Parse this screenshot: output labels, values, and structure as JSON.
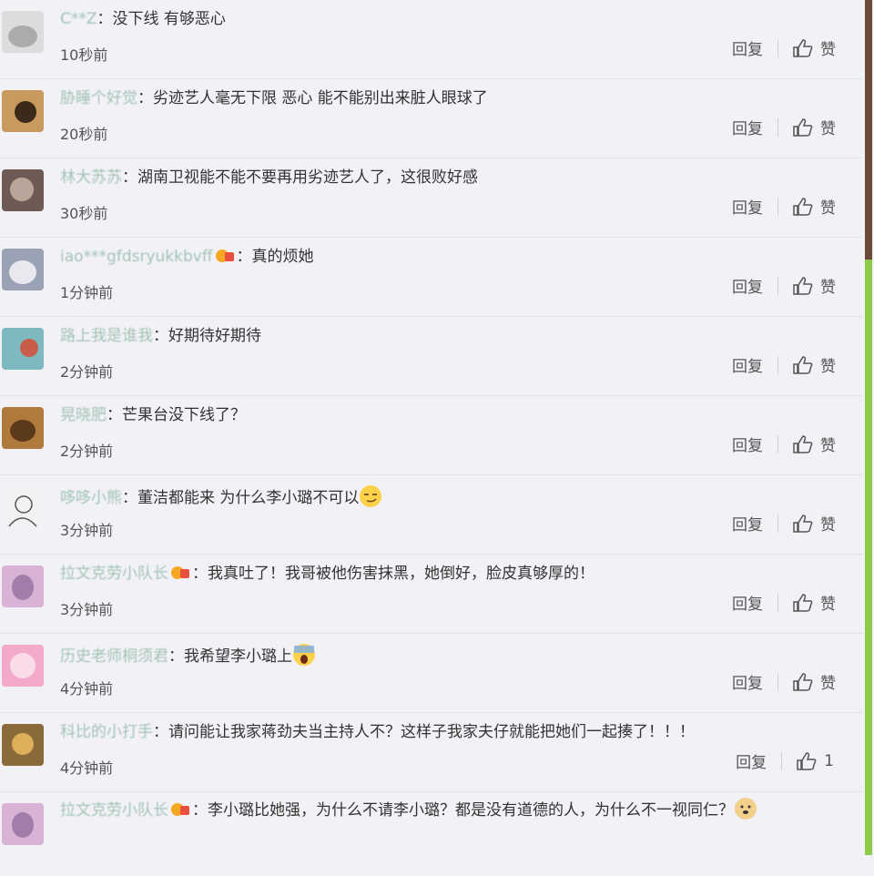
{
  "comments": [
    {
      "user": "C**Z",
      "text": "没下线  有够恶心",
      "time": "10秒前",
      "reply": "回复",
      "like": "赞",
      "avatar_color": "#dcdcdc",
      "avatar_fg": "#7a7a7a"
    },
    {
      "user": "胁睡个好觉",
      "text": "劣迹艺人毫无下限  恶心 能不能别出来脏人眼球了",
      "time": "20秒前",
      "reply": "回复",
      "like": "赞",
      "avatar_color": "#c99a5e",
      "avatar_fg": "#3b2a1a"
    },
    {
      "user": "林大苏苏",
      "text": "湖南卫视能不能不要再用劣迹艺人了，这很败好感",
      "time": "30秒前",
      "reply": "回复",
      "like": "赞",
      "avatar_color": "#6e5a55",
      "avatar_fg": "#d8c5b8"
    },
    {
      "user": "iao***gfdsryukkbvff",
      "text": "真的烦她",
      "time": "1分钟前",
      "reply": "回复",
      "like": "赞",
      "vip": true,
      "avatar_color": "#9aa3b5",
      "avatar_fg": "#e8e8ee"
    },
    {
      "user": "路上我是谁我",
      "text": "好期待好期待",
      "time": "2分钟前",
      "reply": "回复",
      "like": "赞",
      "avatar_color": "#7fb9c0",
      "avatar_fg": "#c95d4a"
    },
    {
      "user": "晃晓肥",
      "text": "芒果台没下线了？",
      "time": "2分钟前",
      "reply": "回复",
      "like": "赞",
      "avatar_color": "#b07a3c",
      "avatar_fg": "#5a3a1a"
    },
    {
      "user": "哆哆小熊",
      "text": "董洁都能来 为什么李小璐不可以",
      "time": "3分钟前",
      "reply": "回复",
      "like": "赞",
      "emoji": "smirk",
      "avatar_color": "#f2f2f5",
      "avatar_fg": "#555"
    },
    {
      "user": "拉文克劳小队长",
      "text": "我真吐了！我哥被他伤害抹黑，她倒好，脸皮真够厚的！",
      "time": "3分钟前",
      "reply": "回复",
      "like": "赞",
      "vip": true,
      "avatar_color": "#d9b3d6",
      "avatar_fg": "#7a5a8a"
    },
    {
      "user": "历史老师桐须君",
      "text": "我希望李小璐上",
      "time": "4分钟前",
      "reply": "回复",
      "like": "赞",
      "emoji": "scream",
      "avatar_color": "#f3a9c9",
      "avatar_fg": "#ffffff"
    },
    {
      "user": "科比的小打手",
      "text": "请问能让我家蒋劲夫当主持人不？这样子我家夫仔就能把她们一起揍了！！！",
      "time": "4分钟前",
      "reply": "回复",
      "like": "1",
      "avatar_color": "#8a6a3a",
      "avatar_fg": "#f0c060"
    },
    {
      "user": "拉文克劳小队长",
      "text": "李小璐比她强，为什么不请李小璐？都是没有道德的人，为什么不一视同仁？",
      "time": "",
      "reply": "",
      "like": "",
      "vip": true,
      "emoji": "doge",
      "avatar_color": "#d9b3d6",
      "avatar_fg": "#7a5a8a"
    }
  ],
  "colors": {
    "accent": "#8fc94a",
    "text": "#333333",
    "muted": "#555555"
  }
}
